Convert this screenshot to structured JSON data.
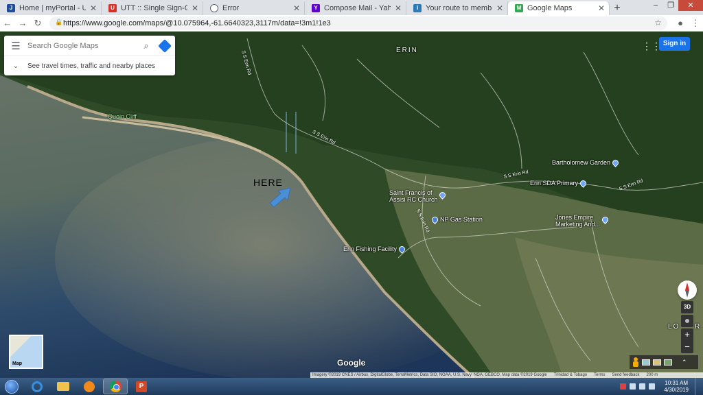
{
  "browser": {
    "tabs": [
      {
        "title": "Home | myPortal - UTT",
        "favicon": "J",
        "color": "#1f4e9c"
      },
      {
        "title": "UTT :: Single Sign-On to all your",
        "favicon": "U",
        "color": "#d93025"
      },
      {
        "title": "Error",
        "favicon": "globe",
        "color": "#5f6368"
      },
      {
        "title": "Compose Mail - Yahoo Mail",
        "favicon": "Y",
        "color": "#5f01d1"
      },
      {
        "title": "Your route to membership | Inst",
        "favicon": "I",
        "color": "#2b7bb9"
      },
      {
        "title": "Google Maps",
        "favicon": "M",
        "color": "#34a853"
      }
    ],
    "new_tab": "+",
    "url": "https://www.google.com/maps/@10.075964,-61.6640323,3117m/data=!3m1!1e3"
  },
  "map": {
    "search_placeholder": "Search Google Maps",
    "travel_times": "See travel times, traffic and nearby places",
    "sign_in": "Sign in",
    "place_labels": {
      "erin": "ERIN",
      "quoin_cliff": "Quoin Cliff",
      "lo": "LO",
      "ro": "R"
    },
    "roads": {
      "ss_erin_1": "S S Erin Rd",
      "ss_erin_2": "S S Erin Rd",
      "ss_erin_3": "S S Erin Rd",
      "ss_erin_4": "S S Erin Rd",
      "ss_erin_5": "S S Erin Rd"
    },
    "pois": {
      "bartholomew": "Bartholomew Garden",
      "erin_sda": "Erin SDA Primary",
      "st_francis_1": "Saint Francis of",
      "st_francis_2": "Assisi RC Church",
      "np_gas": "NP Gas Station",
      "jones_1": "Jones Empire",
      "jones_2": "Marketing And...",
      "fishing": "Erin Fishing Facility"
    },
    "annotation": "HERE",
    "btn_3d": "3D",
    "zoom_in": "+",
    "zoom_out": "−",
    "minimap_label": "Map",
    "google_logo": "Google",
    "attribution": "Imagery ©2019 CNES / Airbus, DigitalGlobe, TerraMetrics, Data SIO, NOAA, U.S. Navy, NGA, GEBCO, Map data ©2019 Google",
    "country": "Trinidad & Tobago",
    "terms": "Terms",
    "feedback": "Send feedback",
    "scale": "200 m"
  },
  "taskbar": {
    "time": "10:31 AM",
    "date": "4/30/2019"
  }
}
